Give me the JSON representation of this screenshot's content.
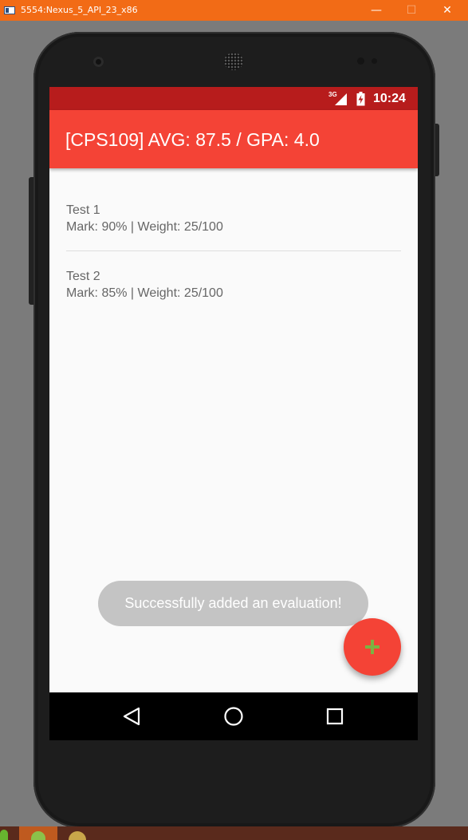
{
  "window": {
    "title": "5554:Nexus_5_API_23_x86",
    "minimize_label": "—",
    "maximize_label": "☐",
    "close_label": "✕"
  },
  "status_bar": {
    "network": "3G",
    "time": "10:24"
  },
  "app_bar": {
    "title": "[CPS109] AVG: 87.5 / GPA: 4.0",
    "color": "#f44336",
    "status_color": "#b71c1c"
  },
  "evaluations": [
    {
      "name": "Test 1",
      "details": "Mark: 90% | Weight: 25/100"
    },
    {
      "name": "Test 2",
      "details": "Mark: 85% | Weight: 25/100"
    }
  ],
  "toast": {
    "message": "Successfully added an evaluation!"
  },
  "fab": {
    "icon": "plus-icon",
    "icon_color": "#7cb342"
  },
  "navigation": {
    "icons": [
      "back-icon",
      "home-icon",
      "recent-apps-icon"
    ]
  }
}
